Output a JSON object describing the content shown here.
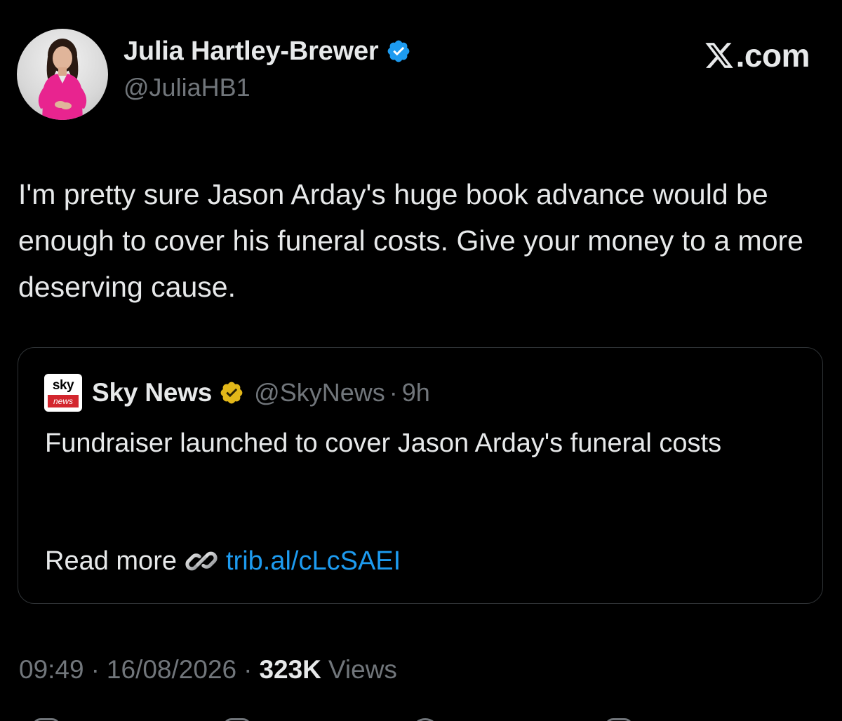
{
  "author": {
    "name": "Julia Hartley-Brewer",
    "handle": "@JuliaHB1",
    "verified_color": "#1d9bf0"
  },
  "brand": {
    "suffix": ".com"
  },
  "tweet": {
    "text": "I'm pretty sure Jason Arday's huge book advance would be enough to cover his funeral costs. Give your money to a more deserving cause."
  },
  "quote": {
    "logo_top": "sky",
    "logo_bottom": "news",
    "author": "Sky News",
    "handle": "@SkyNews",
    "separator": "·",
    "time": "9h",
    "text": "Fundraiser launched to cover Jason Arday's funeral costs",
    "read_more_label": "Read more",
    "link_icon": "link-icon",
    "link_text": "trib.al/cLcSAEI",
    "verified_color": "#e2b719"
  },
  "meta": {
    "time": "09:49",
    "separator": "·",
    "date": "16/08/2026",
    "views_count": "323K",
    "views_label": "Views"
  },
  "actions": [
    "reply-icon",
    "repost-icon",
    "like-icon",
    "bookmark-icon"
  ],
  "colors": {
    "background": "#000000",
    "text": "#e7e9ea",
    "secondary": "#71767b",
    "link": "#1d9bf0",
    "border": "#2f3336"
  }
}
